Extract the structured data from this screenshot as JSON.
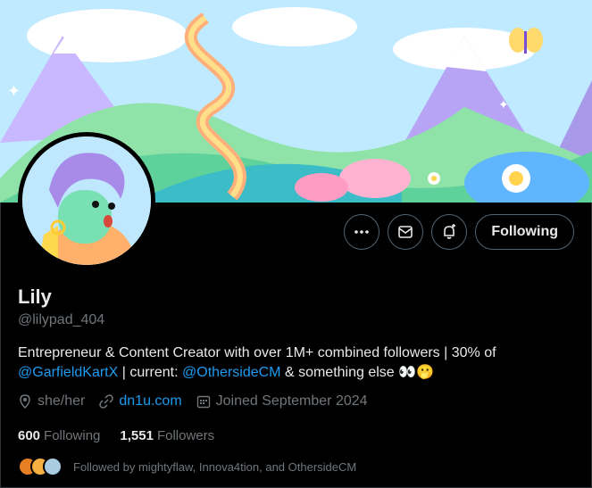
{
  "profile": {
    "name": "Lily",
    "handle": "@lilypad_404",
    "bio_text_1": "Entrepreneur & Content Creator with over 1M+ combined followers | 30% of",
    "bio_link_1": "@GarfieldKartX",
    "bio_text_2": " | current: ",
    "bio_link_2": "@OthersideCM",
    "bio_text_3": " & something else 👀🫢",
    "pronouns": "she/her",
    "website": "dn1u.com",
    "joined": "Joined September 2024"
  },
  "stats": {
    "following_count": "600",
    "following_label": "Following",
    "followers_count": "1,551",
    "followers_label": "Followers"
  },
  "followed_by": "Followed by mightyflaw, Innova4tion, and OthersideCM",
  "actions": {
    "follow_label": "Following"
  },
  "icons": {
    "more": "more-icon",
    "message": "message-icon",
    "notify": "notification-bell-icon",
    "location": "location-pin-icon",
    "link": "link-icon",
    "calendar": "calendar-icon"
  },
  "colors": {
    "accent": "#1d9bf0",
    "background": "#000000",
    "secondary_text": "#71767b"
  }
}
